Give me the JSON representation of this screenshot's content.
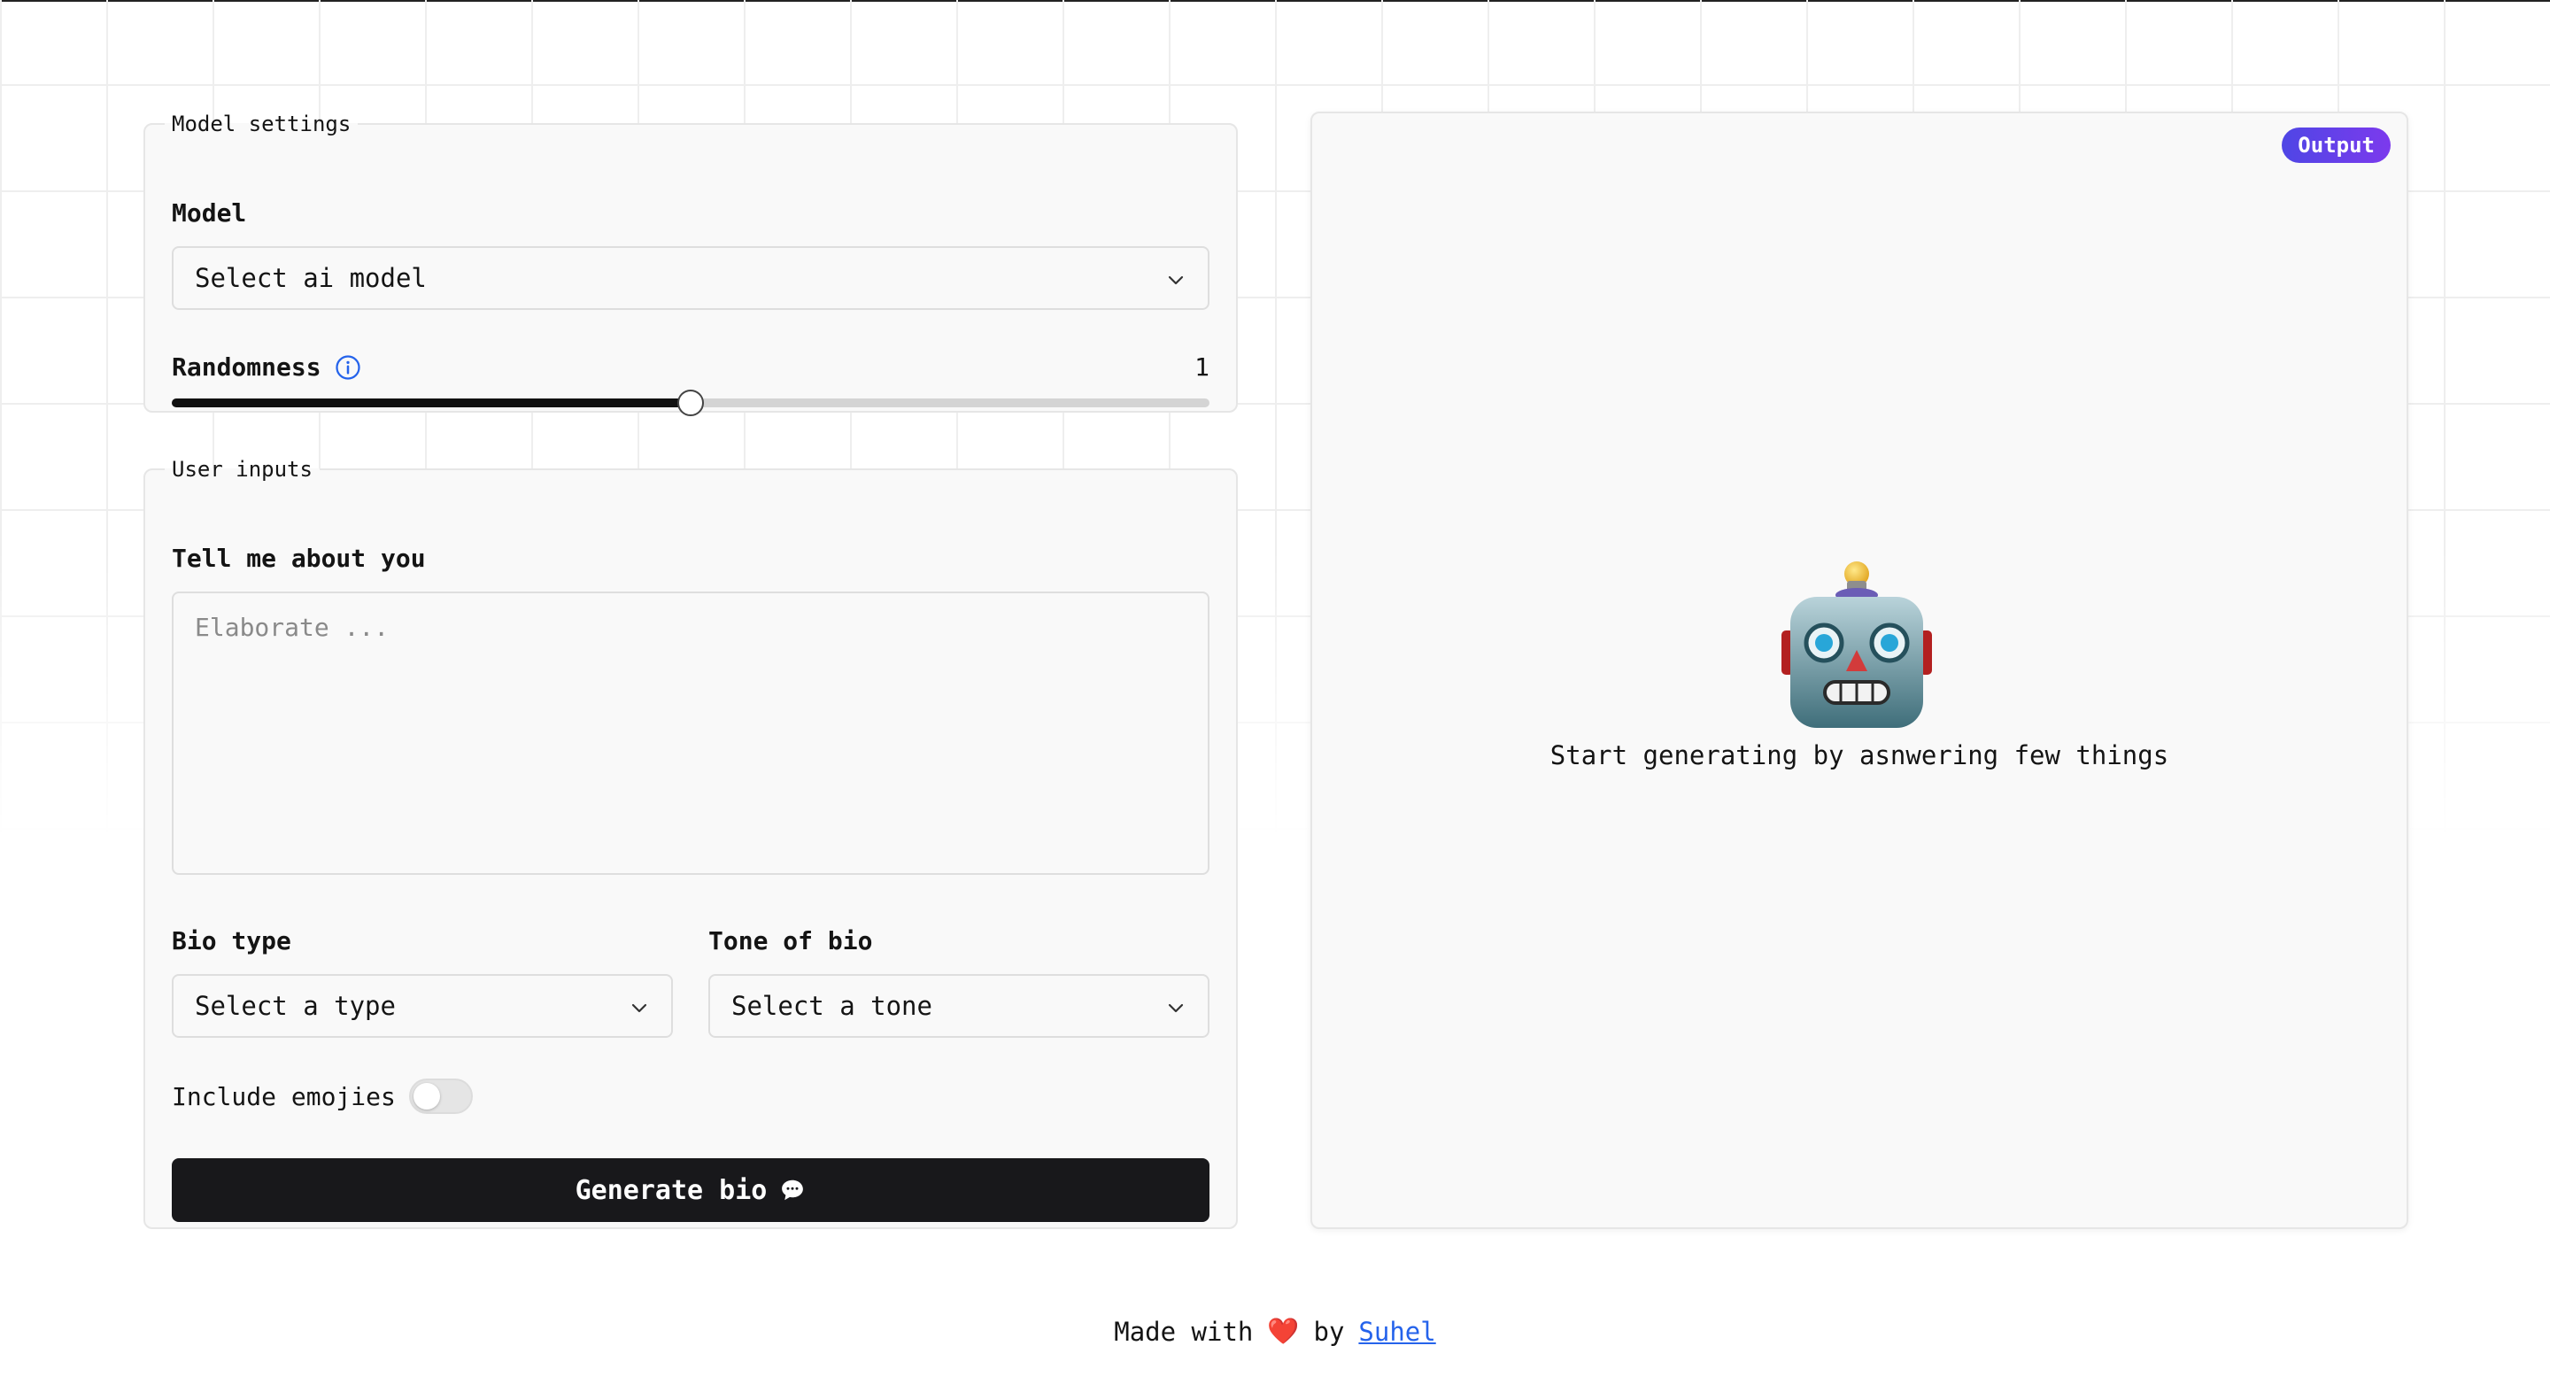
{
  "model_settings": {
    "legend": "Model settings",
    "model_label": "Model",
    "model_placeholder": "Select ai model",
    "randomness_label": "Randomness",
    "randomness_value": "1",
    "randomness_fraction": 0.5
  },
  "user_inputs": {
    "legend": "User inputs",
    "about_label": "Tell me about you",
    "about_placeholder": "Elaborate ...",
    "bio_type_label": "Bio type",
    "bio_type_placeholder": "Select a type",
    "tone_label": "Tone of bio",
    "tone_placeholder": "Select a tone",
    "emoji_label": "Include emojies",
    "emoji_enabled": false,
    "generate_label": "Generate bio",
    "generate_icon": "speech-bubble-icon"
  },
  "output": {
    "badge": "Output",
    "empty_icon": "robot-icon",
    "empty_text": "Start generating by asnwering few things"
  },
  "footer": {
    "made_with": "Made with",
    "heart": "❤️",
    "by": "by",
    "author": "Suhel"
  },
  "colors": {
    "accent_start": "#4f46e5",
    "accent_end": "#7c3aed",
    "button_bg": "#18181b",
    "link": "#2563eb"
  }
}
